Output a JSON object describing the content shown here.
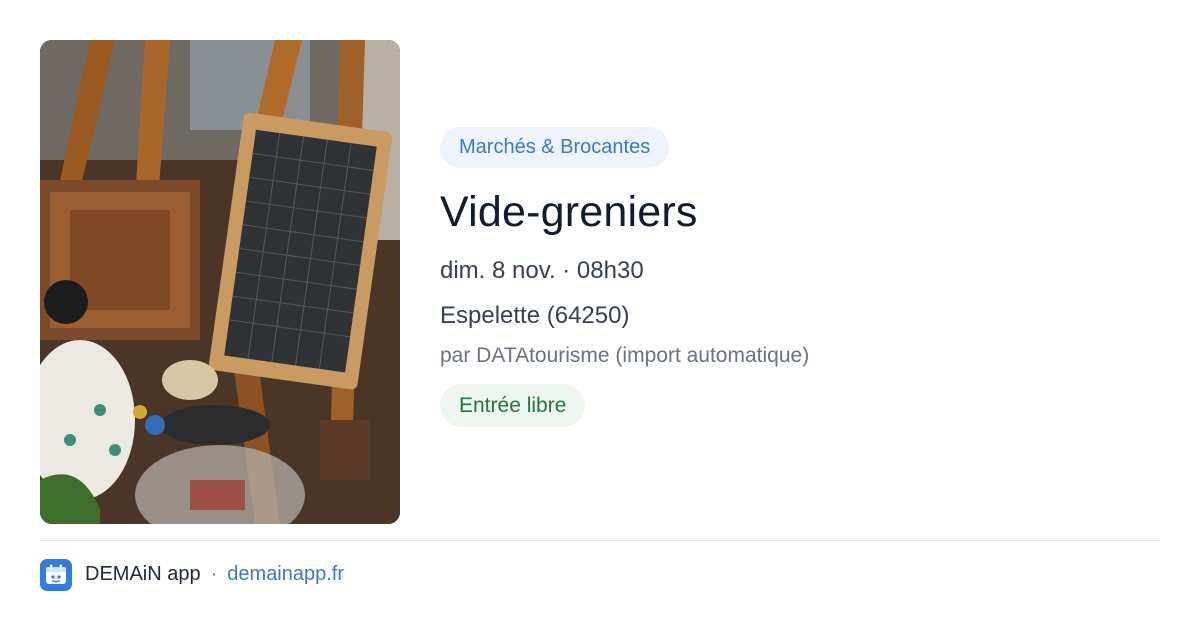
{
  "event": {
    "category": "Marchés & Brocantes",
    "title": "Vide-greniers",
    "datetime": "dim. 8 nov. · 08h30",
    "location": "Espelette (64250)",
    "source": "par DATAtourisme (import automatique)",
    "price": "Entrée libre",
    "image_icon": "flea-market-photo"
  },
  "footer": {
    "app_name": "DEMAiN app",
    "separator": "·",
    "link": "demainapp.fr",
    "icon": "demain-app-icon"
  },
  "colors": {
    "category_badge_bg": "#eef4fd",
    "category_text": "#3b78c9",
    "price_badge_bg": "#edf7ef",
    "price_text": "#1f7a3a",
    "title": "#131c2e",
    "link": "#3b78c9"
  }
}
